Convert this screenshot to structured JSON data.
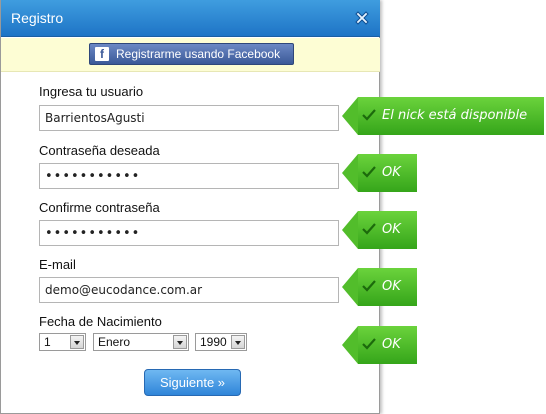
{
  "dialog": {
    "title": "Registro",
    "close_icon": "close-icon"
  },
  "facebook": {
    "icon": "f",
    "label": "Registrarme usando Facebook"
  },
  "form": {
    "username": {
      "label": "Ingresa tu usuario",
      "value": "BarrientosAgusti"
    },
    "password": {
      "label": "Contraseña deseada",
      "value": "•••••••••••"
    },
    "confirm": {
      "label": "Confirme contraseña",
      "value": "•••••••••••"
    },
    "email": {
      "label": "E-mail",
      "value": "demo@eucodance.com.ar"
    },
    "birthdate": {
      "label": "Fecha de Nacimiento",
      "day": "1",
      "month": "Enero",
      "year": "1990"
    },
    "next_label": "Siguiente »"
  },
  "validation": {
    "username_msg": "El nick está disponible",
    "password_msg": "OK",
    "confirm_msg": "OK",
    "email_msg": "OK",
    "birthdate_msg": "OK",
    "color": "#3aaa1e"
  }
}
